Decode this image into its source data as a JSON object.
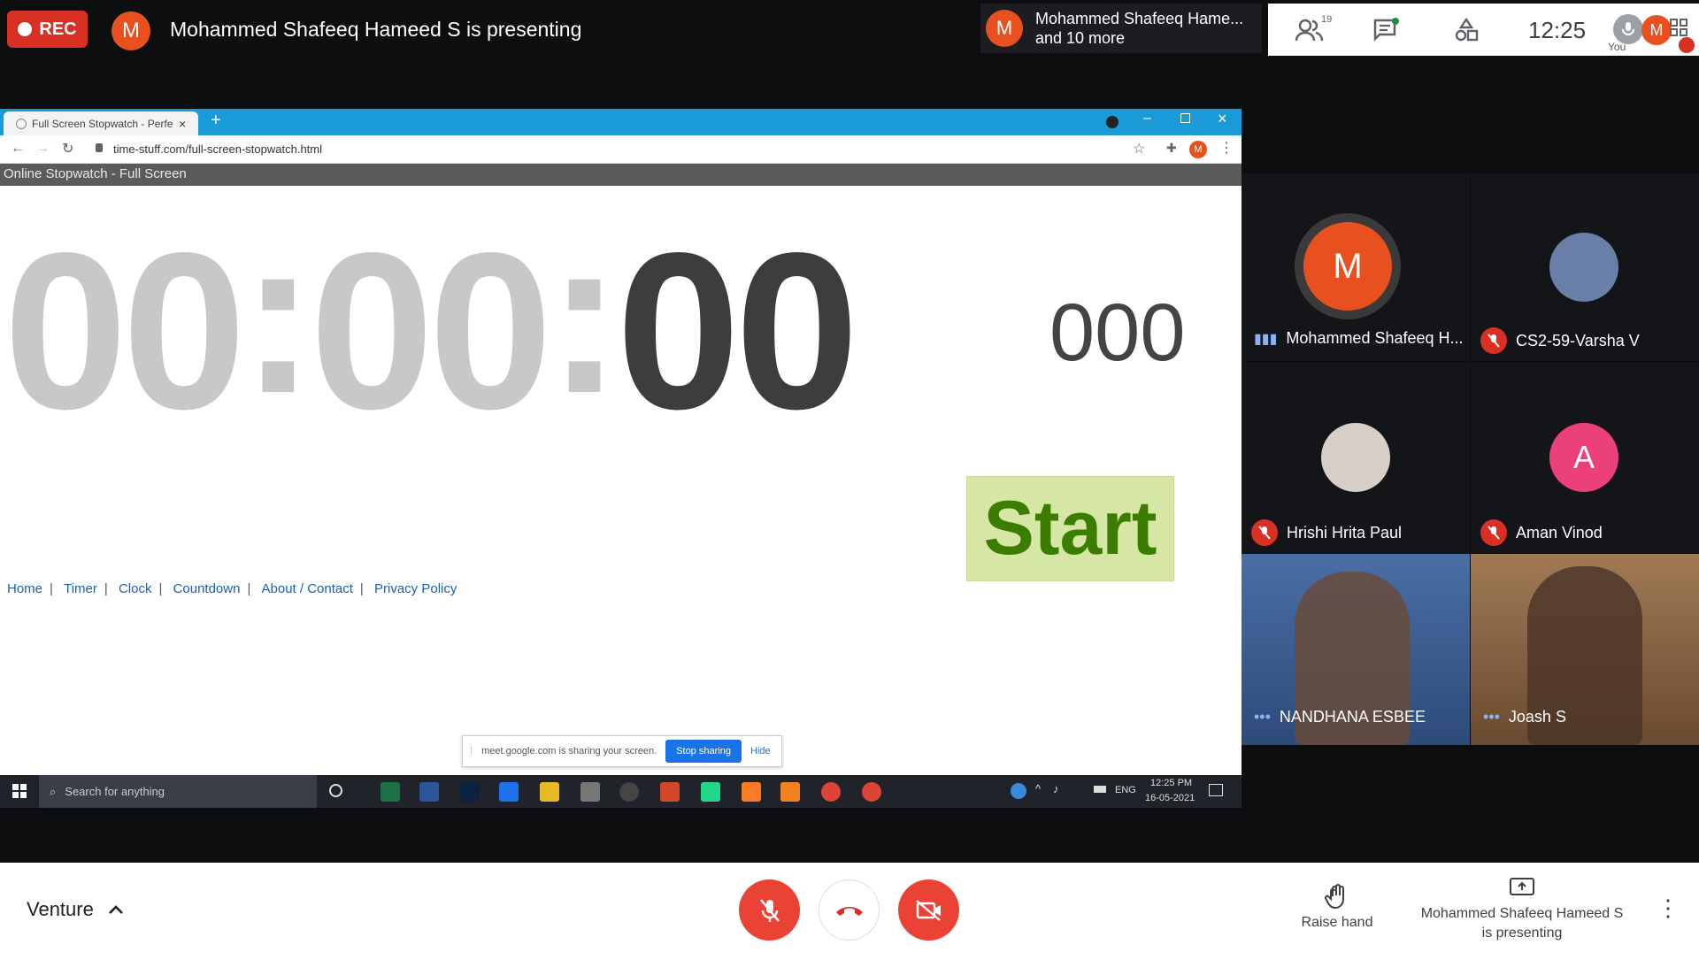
{
  "meet": {
    "rec_label": "REC",
    "presenter_initial": "M",
    "presenting_title": "Mohammed Shafeeq Hameed S is presenting",
    "notification": {
      "line1": "Mohammed Shafeeq Hame...",
      "line2": "and 10 more",
      "initial": "M"
    },
    "people_count": "19",
    "time": "12:25",
    "self_label": "You",
    "self_initial": "M",
    "meeting_name": "Venture",
    "raise_hand_label": "Raise hand",
    "presenting_line1": "Mohammed Shafeeq Hameed S",
    "presenting_line2": "is presenting"
  },
  "browser": {
    "tab_title": "Full Screen Stopwatch - Perfect",
    "url": "time-stuff.com/full-screen-stopwatch.html",
    "page_header": "Online Stopwatch - Full Screen",
    "timer_hh": "00",
    "timer_mm": "00",
    "timer_ss": "00",
    "timer_ms": "000",
    "start_label": "Start",
    "links": [
      "Home",
      "Timer",
      "Clock",
      "Countdown",
      "About / Contact",
      "Privacy Policy"
    ],
    "share_msg": "meet.google.com is sharing your screen.",
    "stop_sharing": "Stop sharing",
    "hide": "Hide",
    "search_placeholder": "Search for anything",
    "tray_lang": "ENG",
    "tray_time": "12:25 PM",
    "tray_date": "16-05-2021"
  },
  "participants": [
    {
      "name": "Mohammed Shafeeq H...",
      "initial": "M",
      "color": "#e8501f"
    },
    {
      "name": "CS2-59-Varsha V",
      "initial": "",
      "color": "#6a7fa8"
    },
    {
      "name": "Hrishi Hrita Paul",
      "initial": "",
      "color": "#d8cfc8"
    },
    {
      "name": "Aman Vinod",
      "initial": "A",
      "color": "#ec407a"
    },
    {
      "name": "NANDHANA ESBEE",
      "initial": "",
      "color": "#4a6fa5"
    },
    {
      "name": "Joash S",
      "initial": "",
      "color": "#8a6a4a"
    }
  ]
}
